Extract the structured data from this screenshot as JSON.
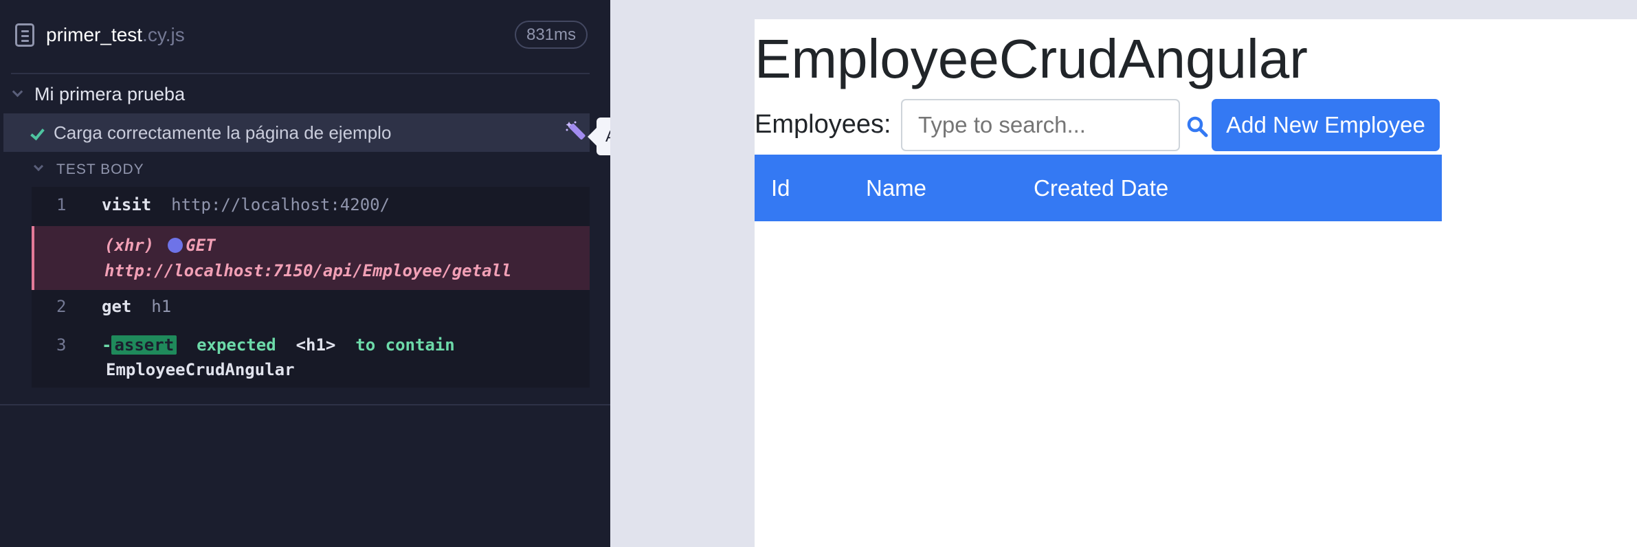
{
  "reporter": {
    "spec_name": "primer_test",
    "spec_ext": ".cy.js",
    "duration": "831ms",
    "suite_title": "Mi primera prueba",
    "test_title": "Carga correctamente la página de ejemplo",
    "tooltip": "Add Commands to Test",
    "body_label": "TEST BODY",
    "commands": [
      {
        "num": "1",
        "name": "visit",
        "arg": "http://localhost:4200/"
      },
      {
        "xhr_type": "(xhr)",
        "method": "GET",
        "url": "http://localhost:7150/api/Employee/getall"
      },
      {
        "num": "2",
        "name": "get",
        "arg": "h1"
      },
      {
        "num": "3",
        "prefix": "-",
        "name": "assert",
        "text1": "expected",
        "element": "<h1>",
        "text2": "to contain",
        "value": "EmployeeCrudAngular"
      }
    ]
  },
  "app": {
    "title": "EmployeeCrudAngular",
    "employees_label": "Employees:",
    "search_placeholder": "Type to search...",
    "add_button": "Add New Employee",
    "columns": [
      "Id",
      "Name",
      "Created Date"
    ]
  }
}
